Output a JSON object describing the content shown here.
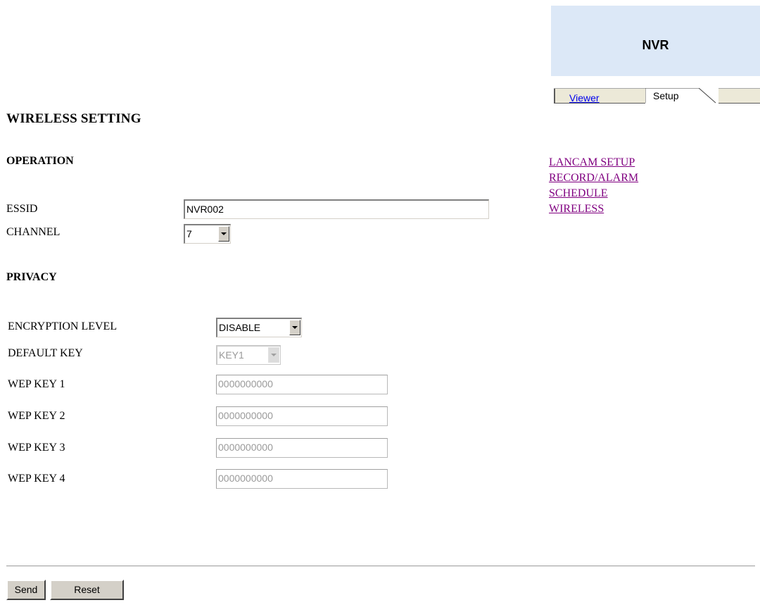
{
  "header": {
    "brand": "NVR",
    "tabs": [
      {
        "label": "Viewer"
      },
      {
        "label": "Setup"
      }
    ]
  },
  "page": {
    "title": "WIRELESS SETTING"
  },
  "operation": {
    "heading": "OPERATION",
    "essid_label": "ESSID",
    "essid_value": "NVR002",
    "channel_label": "CHANNEL",
    "channel_value": "7"
  },
  "privacy": {
    "heading": "PRIVACY",
    "encryption_label": "ENCRYPTION LEVEL",
    "encryption_value": "DISABLE",
    "default_key_label": "DEFAULT KEY",
    "default_key_value": "KEY1",
    "wep_keys": [
      {
        "label": "WEP KEY 1",
        "value": "0000000000"
      },
      {
        "label": "WEP KEY 2",
        "value": "0000000000"
      },
      {
        "label": "WEP KEY 3",
        "value": "0000000000"
      },
      {
        "label": "WEP KEY 4",
        "value": "0000000000"
      }
    ]
  },
  "nav": {
    "links": [
      {
        "label": "LANCAM SETUP"
      },
      {
        "label": "RECORD/ALARM"
      },
      {
        "label": "SCHEDULE"
      },
      {
        "label": "WIRELESS"
      }
    ]
  },
  "actions": {
    "send_label": "Send",
    "reset_label": "Reset"
  },
  "colors": {
    "brand_bg": "#dce8f7",
    "visited_link": "#800080",
    "link": "#0000ee",
    "button_face": "#d4d0c8"
  }
}
